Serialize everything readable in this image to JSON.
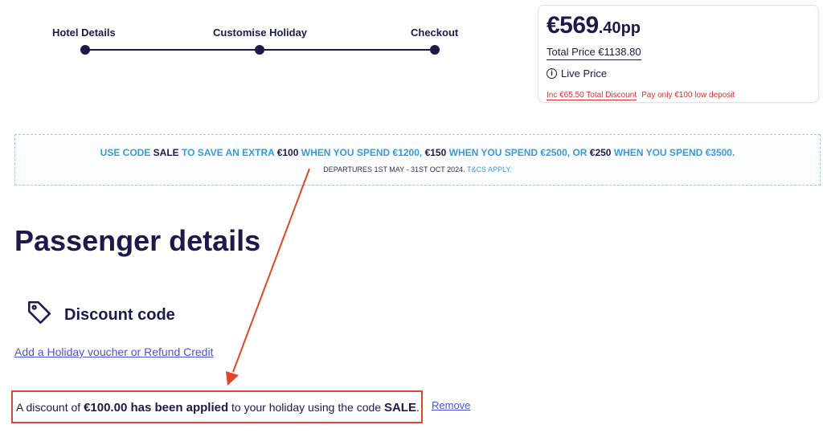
{
  "stepper": {
    "steps": [
      {
        "label": "Hotel Details"
      },
      {
        "label": "Customise Holiday"
      },
      {
        "label": "Checkout"
      }
    ]
  },
  "price": {
    "main": "€569",
    "decimals": ".40",
    "unit": "pp",
    "total": "Total Price €1138.80",
    "live_icon": "i",
    "live": "Live Price",
    "discount": "Inc €65.50 Total Discount",
    "deposit": "Pay only €100 low deposit"
  },
  "promo": {
    "line1": [
      {
        "text": "USE CODE ",
        "dark": false
      },
      {
        "text": "SALE",
        "dark": true
      },
      {
        "text": " TO SAVE AN EXTRA ",
        "dark": false
      },
      {
        "text": "€100",
        "dark": true
      },
      {
        "text": " WHEN YOU SPEND €1200, ",
        "dark": false
      },
      {
        "text": "€150",
        "dark": true
      },
      {
        "text": " WHEN YOU SPEND €2500, OR ",
        "dark": false
      },
      {
        "text": "€250",
        "dark": true
      },
      {
        "text": " WHEN YOU SPEND €3500.",
        "dark": false
      }
    ],
    "line2_text": "DEPARTURES 1ST MAY - 31ST OCT 2024. ",
    "line2_link": "T&CS APPLY."
  },
  "page_title": "Passenger details",
  "discount_section": {
    "icon": "tag-icon",
    "title": "Discount code",
    "voucher_link": "Add a Holiday voucher or Refund Credit",
    "applied": {
      "prefix": "A discount of ",
      "amount": "€100.00 has been applied",
      "middle": " to your holiday using the code ",
      "code": "SALE",
      "suffix": "."
    },
    "remove": "Remove"
  },
  "colors": {
    "navy": "#1b1a4a",
    "promo_blue": "#3b9ad6",
    "alert_red": "#d8332d",
    "annotation": "#e0472a",
    "link": "#4a55d3"
  }
}
